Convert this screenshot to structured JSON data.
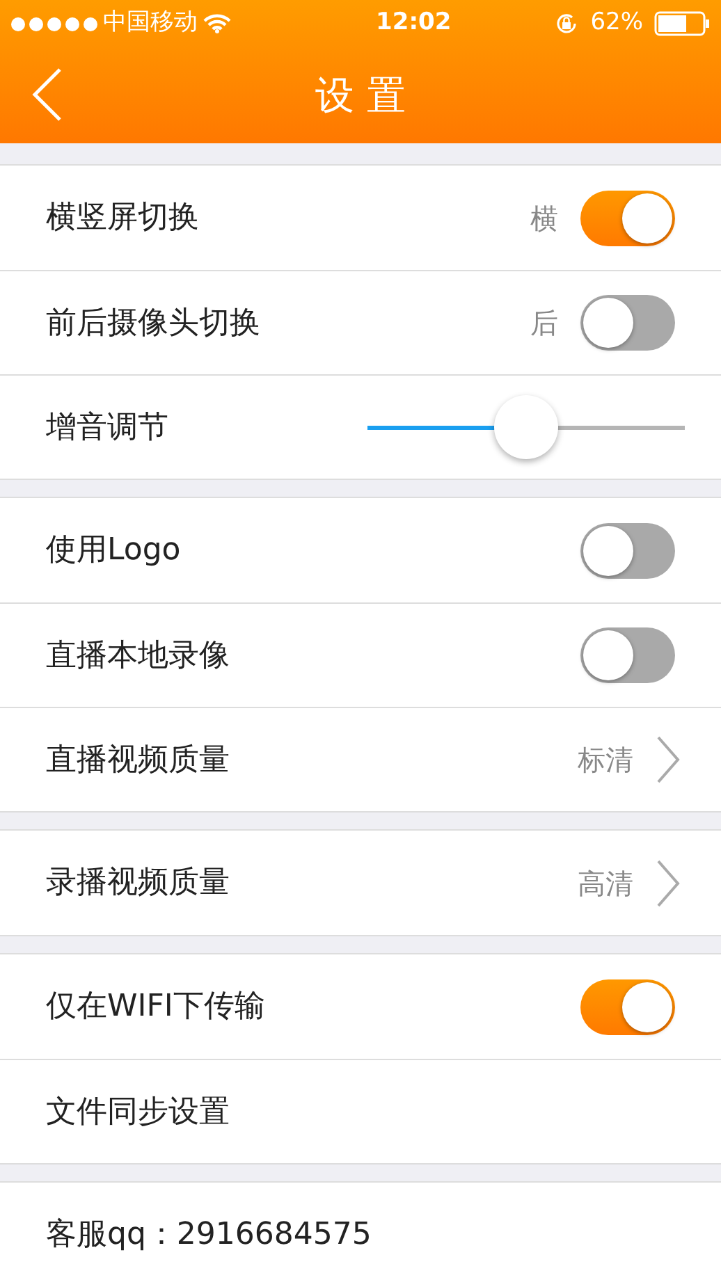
{
  "status_bar": {
    "carrier": "中国移动",
    "time": "12:02",
    "battery": "62%"
  },
  "nav": {
    "title": "设 置"
  },
  "groups": [
    {
      "rows": [
        {
          "kind": "toggle",
          "label": "横竖屏切换",
          "value": "横",
          "on": true
        },
        {
          "kind": "toggle",
          "label": "前后摄像头切换",
          "value": "后",
          "on": false
        },
        {
          "kind": "slider",
          "label": "增音调节",
          "level": 0.5
        }
      ]
    },
    {
      "rows": [
        {
          "kind": "toggle",
          "label": "使用Logo",
          "on": false
        },
        {
          "kind": "toggle",
          "label": "直播本地录像",
          "on": false
        },
        {
          "kind": "link",
          "label": "直播视频质量",
          "value": "标清"
        }
      ]
    },
    {
      "rows": [
        {
          "kind": "link",
          "label": "录播视频质量",
          "value": "高清"
        }
      ]
    },
    {
      "rows": [
        {
          "kind": "toggle",
          "label": "仅在WIFI下传输",
          "on": true
        },
        {
          "kind": "plain",
          "label": "文件同步设置"
        }
      ]
    },
    {
      "rows": [
        {
          "kind": "plain",
          "label": "客服qq：2916684575"
        }
      ]
    }
  ]
}
